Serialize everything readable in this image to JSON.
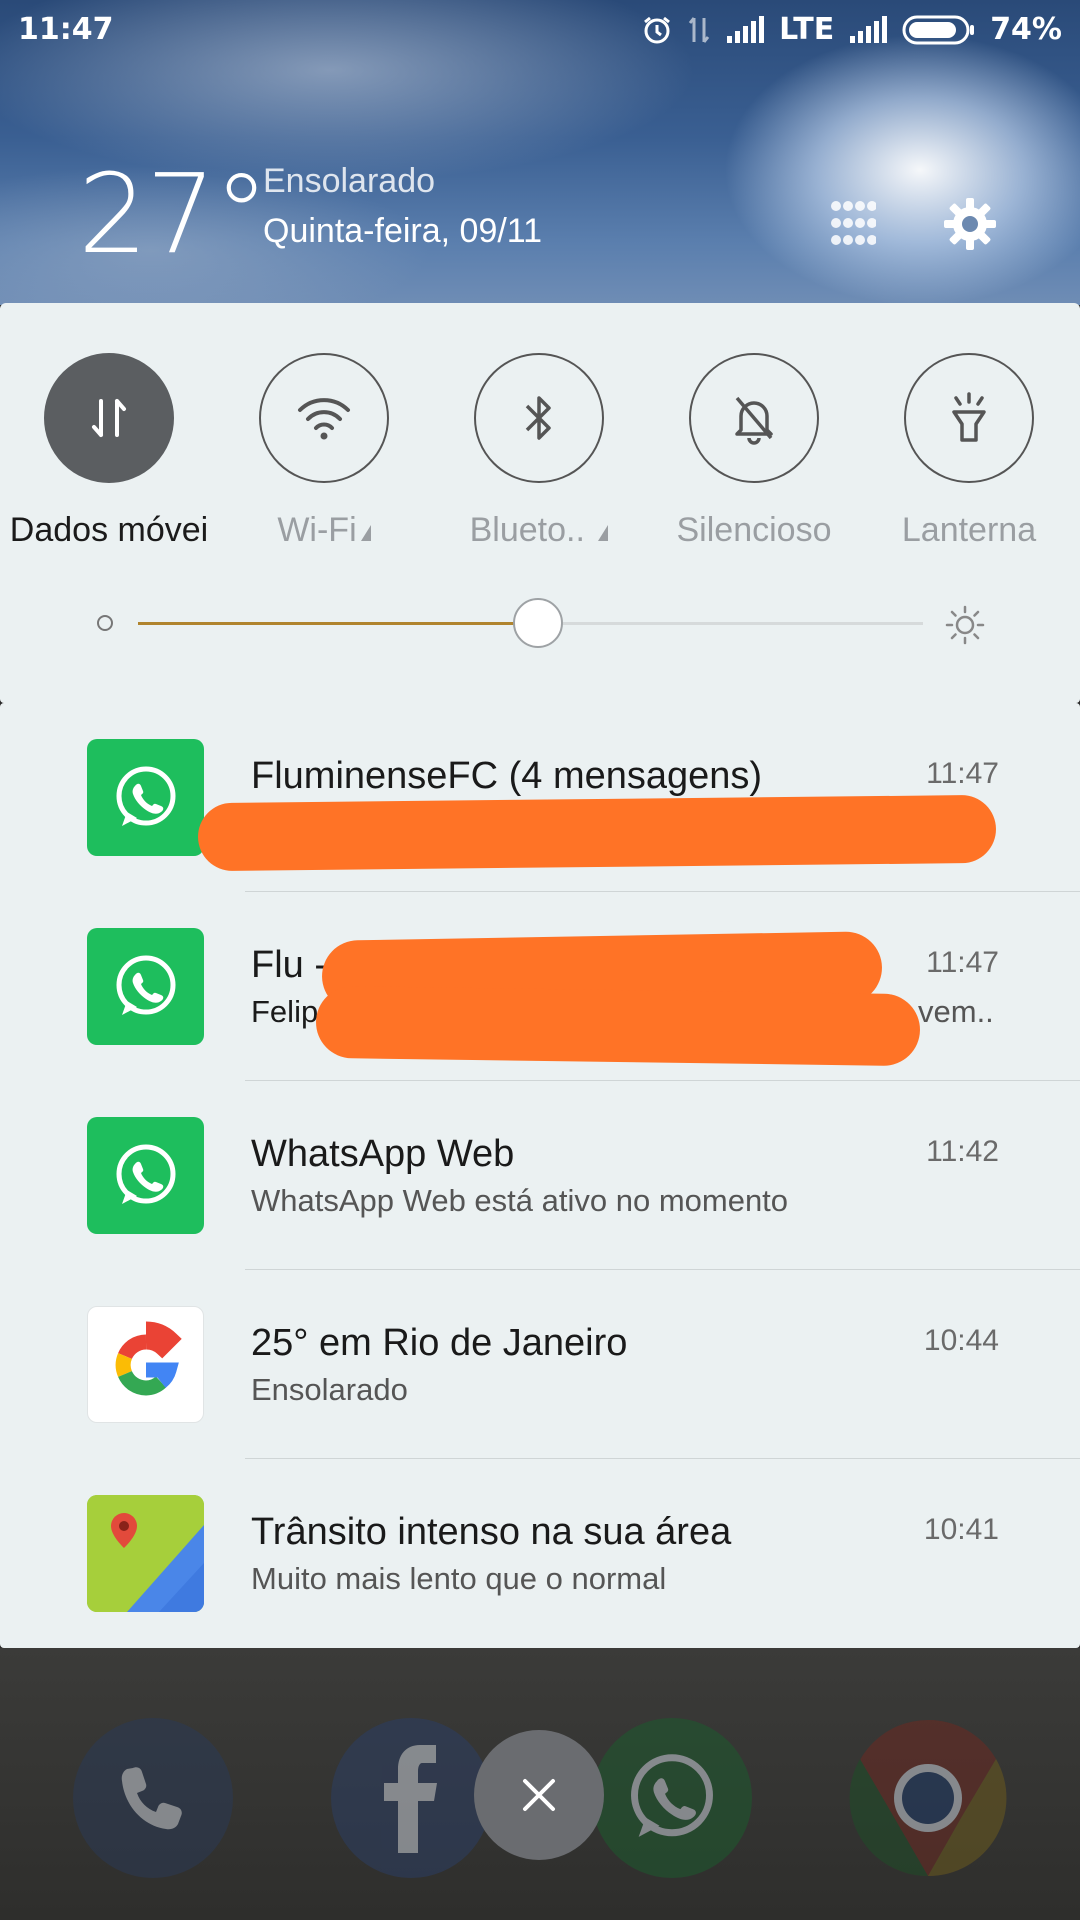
{
  "status_bar": {
    "time": "11:47",
    "network": "LTE",
    "battery": "74%",
    "battery_level": 0.74
  },
  "weather": {
    "temperature": "27°",
    "condition": "Ensolarado",
    "date": "Quinta-feira, 09/11"
  },
  "quick_settings": {
    "toggles": [
      {
        "label": "Dados móvei",
        "icon": "mobile-data-icon",
        "active": true
      },
      {
        "label": "Wi-Fi",
        "icon": "wifi-icon",
        "active": false
      },
      {
        "label": "Blueto..",
        "icon": "bluetooth-icon",
        "active": false
      },
      {
        "label": "Silencioso",
        "icon": "bell-off-icon",
        "active": false
      },
      {
        "label": "Lanterna",
        "icon": "flashlight-icon",
        "active": false
      }
    ],
    "brightness_level": 0.51,
    "colors": {
      "slider_fill": "#b0842e",
      "active_toggle": "#5b5e61"
    }
  },
  "notifications": [
    {
      "title": "FluminenseFC (4 mensagens)",
      "subtitle": "",
      "time": "11:47",
      "app": "whatsapp-icon",
      "redacted": true
    },
    {
      "title": "Flu -",
      "subtitle": "Felip",
      "time": "11:47",
      "trailing_text": "vem..",
      "app": "whatsapp-icon",
      "redacted": true
    },
    {
      "title": "WhatsApp Web",
      "subtitle": "WhatsApp Web está ativo no momento",
      "time": "11:42",
      "app": "whatsapp-icon"
    },
    {
      "title": "25° em Rio de Janeiro",
      "subtitle": "Ensolarado",
      "time": "10:44",
      "app": "google-icon"
    },
    {
      "title": "Trânsito intenso na sua área",
      "subtitle": "Muito mais lento que o normal",
      "time": "10:41",
      "app": "maps-icon"
    }
  ],
  "dock": {
    "apps": [
      "phone-icon",
      "facebook-icon",
      "whatsapp-icon",
      "chrome-icon"
    ]
  },
  "brand_colors": {
    "whatsapp": "#1ebe5d",
    "redaction": "#ff7326"
  }
}
